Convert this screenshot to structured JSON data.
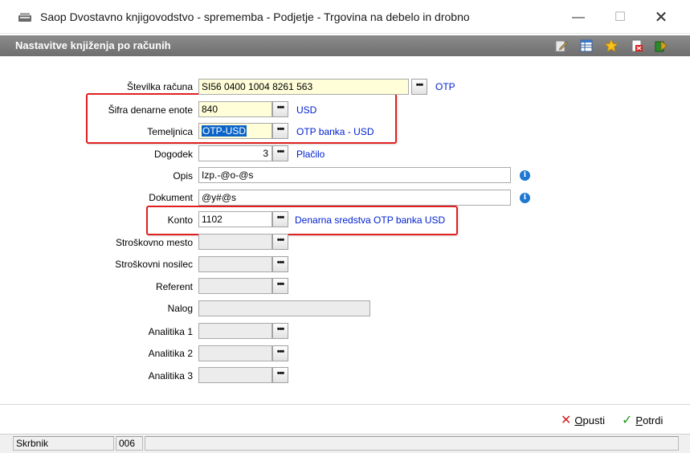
{
  "window": {
    "title": "Saop Dvostavno knjigovodstvo - sprememba - Podjetje - Trgovina na debelo in drobno",
    "minimize": "—",
    "maximize": "☐",
    "close": "✕"
  },
  "header": {
    "title": "Nastavitve knjiženja po računih",
    "toolbar_icons": [
      "edit-icon",
      "table-icon",
      "star-icon",
      "export-icon",
      "run-icon"
    ]
  },
  "form": {
    "dots": "•••",
    "stevilka_racuna": {
      "label": "Številka računa",
      "value": "SI56 0400 1004 8261 563",
      "desc": "OTP"
    },
    "sifra_denarne_enote": {
      "label": "Šifra denarne enote",
      "value": "840",
      "desc": "USD"
    },
    "temeljnica": {
      "label": "Temeljnica",
      "value": "OTP-USD",
      "desc": "OTP banka  - USD"
    },
    "dogodek": {
      "label": "Dogodek",
      "value": "3",
      "desc": "Plačilo"
    },
    "opis": {
      "label": "Opis",
      "value": "Izp.-@o-@s",
      "info": "i"
    },
    "dokument": {
      "label": "Dokument",
      "value": "@y#@s",
      "info": "i"
    },
    "konto": {
      "label": "Konto",
      "value": "1102",
      "desc": "Denarna sredstva OTP banka USD"
    },
    "stroskovno_mesto": {
      "label": "Stroškovno mesto",
      "value": ""
    },
    "stroskovni_nosilec": {
      "label": "Stroškovni nosilec",
      "value": ""
    },
    "referent": {
      "label": "Referent",
      "value": ""
    },
    "nalog": {
      "label": "Nalog",
      "value": ""
    },
    "analitika1": {
      "label": "Analitika 1",
      "value": ""
    },
    "analitika2": {
      "label": "Analitika 2",
      "value": ""
    },
    "analitika3": {
      "label": "Analitika 3",
      "value": ""
    }
  },
  "actions": {
    "cancel_icon": "✕",
    "cancel_first": "O",
    "cancel_rest": "pusti",
    "confirm_icon": "✓",
    "confirm_first": "P",
    "confirm_rest": "otrdi"
  },
  "status": {
    "user_label": "Skrbnik",
    "code": "006"
  },
  "colors": {
    "header_bg": "#7a7a7a",
    "description_text": "#0020d0",
    "required_field": "#fffed9",
    "disabled_field": "#ececec",
    "highlight_box": "#e02020",
    "selection": "#0a64c8"
  }
}
